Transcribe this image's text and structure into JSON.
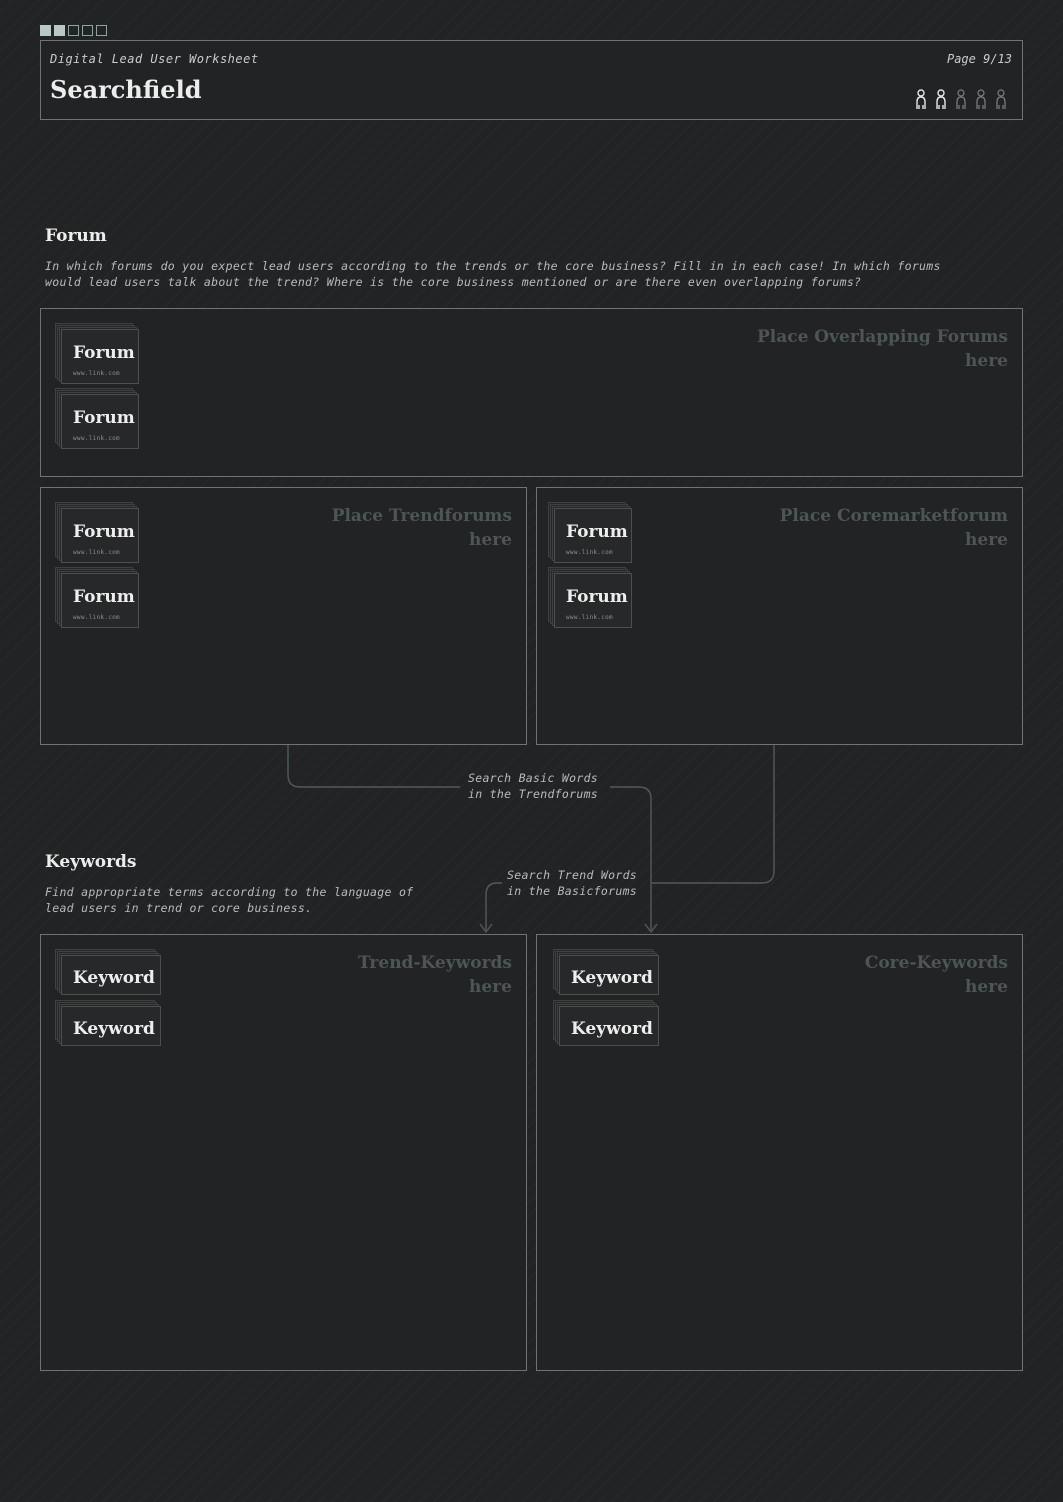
{
  "header": {
    "doc_label": "Digital Lead User Worksheet",
    "page_label": "Page 9/13",
    "title": "Searchfield",
    "progress_total": 5,
    "progress_filled": 2,
    "persons_total": 5,
    "persons_filled": 2
  },
  "forum_section": {
    "title": "Forum",
    "description_line1": "In which forums do you expect lead users according to the trends or the core business? Fill in in each case! In which forums",
    "description_line2": "would lead users talk about the trend? Where is the core business mentioned or are there even overlapping forums?"
  },
  "overlap_box": {
    "placeholder_line1": "Place Overlapping Forums",
    "placeholder_line2": "here",
    "cards": [
      {
        "title": "Forum",
        "link": "www.link.com"
      },
      {
        "title": "Forum",
        "link": "www.link.com"
      }
    ]
  },
  "trend_forums_box": {
    "placeholder_line1": "Place Trendforums",
    "placeholder_line2": "here",
    "cards": [
      {
        "title": "Forum",
        "link": "www.link.com"
      },
      {
        "title": "Forum",
        "link": "www.link.com"
      }
    ]
  },
  "core_forums_box": {
    "placeholder_line1": "Place Coremarketforum",
    "placeholder_line2": "here",
    "cards": [
      {
        "title": "Forum",
        "link": "www.link.com"
      },
      {
        "title": "Forum",
        "link": "www.link.com"
      }
    ]
  },
  "flows": {
    "basic_words_line1": "Search Basic Words",
    "basic_words_line2": "in the Trendforums",
    "trend_words_line1": "Search Trend Words",
    "trend_words_line2": "in the Basicforums"
  },
  "keywords_section": {
    "title": "Keywords",
    "description_line1": "Find appropriate terms according to the language of",
    "description_line2": "lead users in trend or core business."
  },
  "trend_keywords_box": {
    "placeholder_line1": "Trend-Keywords",
    "placeholder_line2": "here",
    "cards": [
      {
        "title": "Keyword"
      },
      {
        "title": "Keyword"
      }
    ]
  },
  "core_keywords_box": {
    "placeholder_line1": "Core-Keywords",
    "placeholder_line2": "here",
    "cards": [
      {
        "title": "Keyword"
      },
      {
        "title": "Keyword"
      }
    ]
  },
  "colors": {
    "background": "#222325",
    "border": "#6e7472",
    "placeholder": "#4d5654",
    "connector": "#4f5c59",
    "accent": "#b7c9c6"
  }
}
